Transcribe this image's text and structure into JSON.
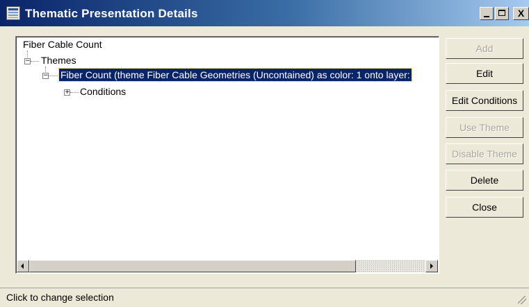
{
  "window": {
    "title": "Thematic Presentation Details",
    "min_glyph": "_",
    "max_glyph": "□",
    "close_glyph": "X"
  },
  "tree": {
    "root": "Fiber Cable Count",
    "themes_label": "Themes",
    "selected_item": "Fiber Count (theme Fiber Cable Geometries (Uncontained) as color: 1 onto layer:",
    "conditions_label": "Conditions",
    "expander_minus": "−",
    "expander_plus": "+"
  },
  "buttons": {
    "add": "Add",
    "edit": "Edit",
    "edit_conditions": "Edit Conditions",
    "use_theme": "Use Theme",
    "disable_theme": "Disable Theme",
    "delete": "Delete",
    "close": "Close"
  },
  "button_states": {
    "add_enabled": false,
    "use_theme_enabled": false,
    "disable_theme_enabled": false
  },
  "status": {
    "text": "Click to change selection"
  },
  "colors": {
    "titlebar_start": "#0a246a",
    "selection": "#0a246a",
    "face": "#ece9d8"
  }
}
